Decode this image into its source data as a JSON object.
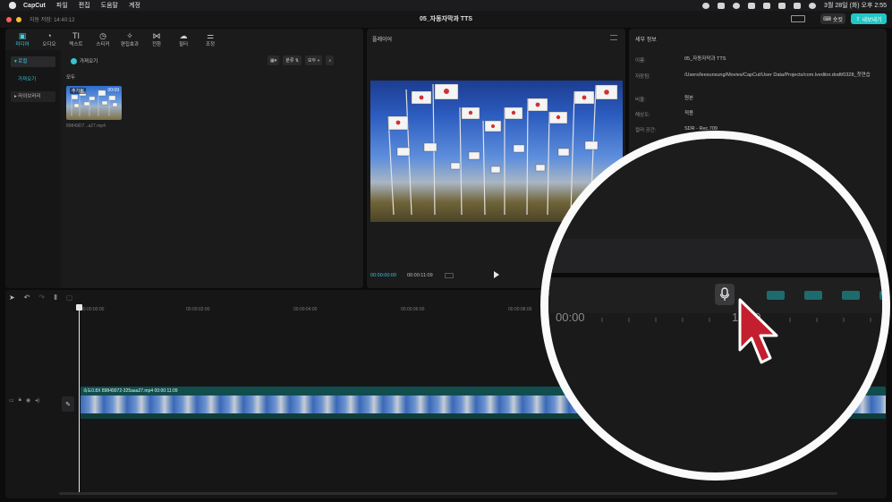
{
  "menubar": {
    "app": "CapCut",
    "items": [
      "파일",
      "편집",
      "도움말",
      "계정"
    ],
    "datetime": "3월 28일 (화) 오후 2:55"
  },
  "window": {
    "autosave": "자동 저장: 14:40:12",
    "title": "05_자동자막과 TTS",
    "shortcut_label": "숏컷",
    "export_label": "내보내기"
  },
  "toolbar": {
    "tools": [
      {
        "label": "미디어",
        "icon": "media-icon"
      },
      {
        "label": "오디오",
        "icon": "audio-icon"
      },
      {
        "label": "텍스트",
        "icon": "text-icon"
      },
      {
        "label": "스티커",
        "icon": "sticker-icon"
      },
      {
        "label": "편집효과",
        "icon": "effects-icon"
      },
      {
        "label": "전환",
        "icon": "transition-icon"
      },
      {
        "label": "필터",
        "icon": "filter-icon"
      },
      {
        "label": "조정",
        "icon": "adjust-icon"
      }
    ]
  },
  "sidebar": {
    "local": "▾ 로컬",
    "import": "가져오기",
    "library": "▸ 라이브러리"
  },
  "media": {
    "import_button": "가져오기",
    "all_label": "모두",
    "sort_label": "분류",
    "filter_label": "모두",
    "thumb_tag": "추가됨",
    "thumb_duration": "00:09",
    "thumb_name": "89849D7...a27.mp4"
  },
  "player": {
    "title": "플레이어",
    "current_time": "00:00:00:00",
    "total_time": "00:00:11:09"
  },
  "details": {
    "title": "세부 정보",
    "rows": [
      {
        "key": "이름:",
        "value": "05_자동자막과 TTS"
      },
      {
        "key": "저장됨:",
        "value": "/Users/leesunsung/Movies/CapCut/User Data/Projects/com.lveditor.draft/0328_첫연습"
      },
      {
        "key": "비율:",
        "value": "원본"
      },
      {
        "key": "해상도:",
        "value": "적용"
      },
      {
        "key": "컬러 공간:",
        "value": "SDR - Rec.709"
      }
    ]
  },
  "timeline": {
    "ruler": [
      "00:00:00:00",
      "00:00:02:00",
      "00:00:04:00",
      "00:00:06:00",
      "00:00:08:00"
    ],
    "clip_label": "속도0.8X  89849072-325aaa27.mp4  00:00:11:09"
  },
  "zoom": {
    "tc_left": "00:00",
    "tc_mid": "12:00"
  }
}
